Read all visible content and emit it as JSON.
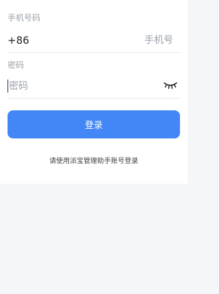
{
  "form": {
    "phone_label": "手机号码",
    "phone_prefix": "+86",
    "phone_placeholder": "手机号",
    "password_label": "密码",
    "password_placeholder": "密码",
    "password_toggle_icon": "eye-closed-icon",
    "login_label": "登录",
    "alt_login_text": "请使用派宝管理助手账号登录"
  },
  "colors": {
    "primary": "#4287f5",
    "background": "#f5f6f8",
    "card": "#ffffff",
    "placeholder": "#9aa0a8"
  }
}
